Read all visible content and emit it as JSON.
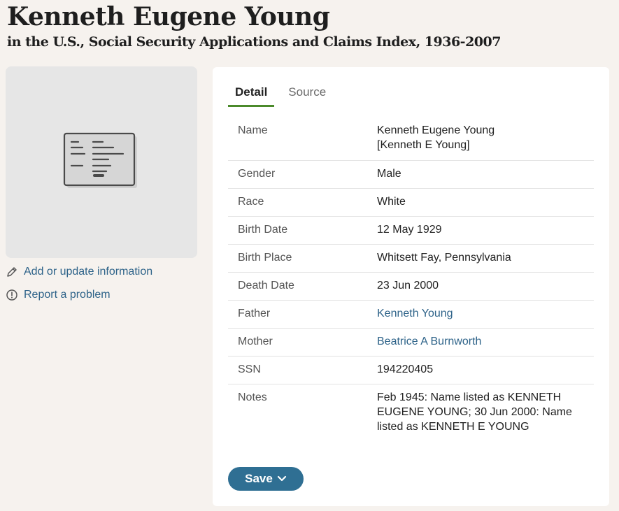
{
  "header": {
    "title": "Kenneth Eugene Young",
    "subtitle": "in the U.S., Social Security Applications and Claims Index, 1936-2007"
  },
  "sidebar": {
    "image_icon": "document-card-icon",
    "add_update_label": "Add or update information",
    "report_label": "Report a problem"
  },
  "tabs": {
    "detail": "Detail",
    "source": "Source"
  },
  "details": {
    "name_label": "Name",
    "name_value": "Kenneth Eugene Young",
    "name_alt": "[Kenneth E Young]",
    "gender_label": "Gender",
    "gender_value": "Male",
    "race_label": "Race",
    "race_value": "White",
    "birth_date_label": "Birth Date",
    "birth_date_value": "12 May 1929",
    "birth_place_label": "Birth Place",
    "birth_place_value": "Whitsett Fay, Pennsylvania",
    "death_date_label": "Death Date",
    "death_date_value": "23 Jun 2000",
    "father_label": "Father",
    "father_value": "Kenneth Young",
    "mother_label": "Mother",
    "mother_value": "Beatrice A Burnworth",
    "ssn_label": "SSN",
    "ssn_value": "194220405",
    "notes_label": "Notes",
    "notes_value": "Feb 1945: Name listed as KENNETH EUGENE YOUNG; 30 Jun 2000: Name listed as KENNETH E YOUNG"
  },
  "actions": {
    "save_label": "Save"
  },
  "colors": {
    "link": "#2e6389",
    "accent_tab": "#4b8a2b",
    "save_button": "#2f6f93",
    "background": "#f6f2ee"
  }
}
